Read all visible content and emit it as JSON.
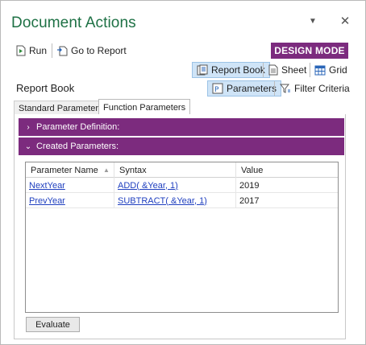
{
  "pane": {
    "title": "Document Actions",
    "dropdown_glyph": "▼",
    "close_glyph": "✕"
  },
  "toolbar": {
    "run_label": "Run",
    "goto_label": "Go to Report",
    "mode_badge": "DESIGN MODE"
  },
  "view_switcher": {
    "report_book_label": "Report Book",
    "sheet_label": "Sheet",
    "grid_label": "Grid"
  },
  "section": {
    "title": "Report Book",
    "parameters_label": "Parameters",
    "filter_label": "Filter Criteria"
  },
  "tabs": [
    {
      "label": "Standard Parameters",
      "active": false
    },
    {
      "label": "Function Parameters",
      "active": true
    }
  ],
  "bars": {
    "definition": {
      "label": "Parameter Definition:",
      "chevron": "›"
    },
    "created": {
      "label": "Created Parameters:",
      "chevron": "⌄"
    }
  },
  "table": {
    "columns": [
      "Parameter Name",
      "Syntax",
      "Value"
    ],
    "sort_glyph": "▲",
    "rows": [
      {
        "name": "NextYear",
        "syntax": "ADD( &Year, 1)",
        "value": "2019"
      },
      {
        "name": "PrevYear",
        "syntax": "SUBTRACT( &Year, 1)",
        "value": "2017"
      }
    ]
  },
  "evaluate_label": "Evaluate",
  "colors": {
    "accent_purple": "#7c2b7e",
    "title_green": "#1e7145",
    "link_blue": "#1f3fbf",
    "highlight": "#cfe4f7"
  }
}
